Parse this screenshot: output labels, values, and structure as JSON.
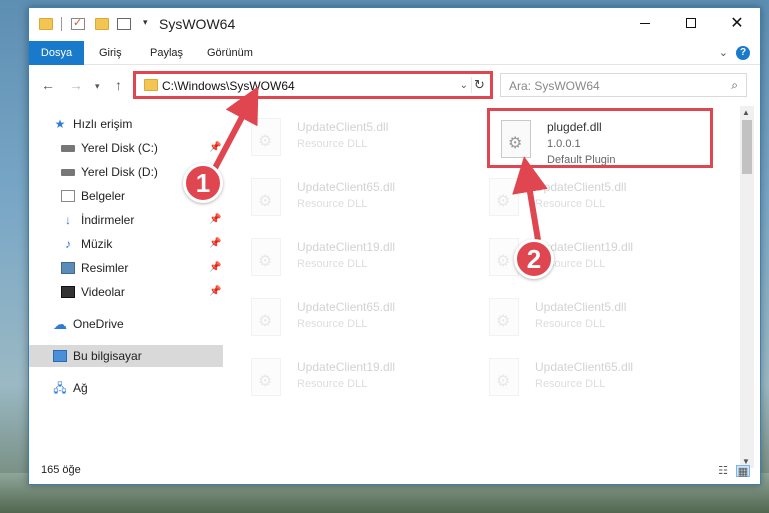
{
  "window": {
    "title": "SysWOW64"
  },
  "ribbon": {
    "tabs": [
      "Dosya",
      "Giriş",
      "Paylaş",
      "Görünüm"
    ],
    "help": "?"
  },
  "address": {
    "path": "C:\\Windows\\SysWOW64",
    "search_placeholder": "Ara: SysWOW64"
  },
  "nav": {
    "items": [
      {
        "label": "Hızlı erişim",
        "icon": "star-icon"
      },
      {
        "label": "Yerel Disk (C:)",
        "icon": "drive-icon",
        "pinned": true
      },
      {
        "label": "Yerel Disk (D:)",
        "icon": "drive-icon"
      },
      {
        "label": "Belgeler",
        "icon": "documents-icon"
      },
      {
        "label": "İndirmeler",
        "icon": "download-icon",
        "pinned": true
      },
      {
        "label": "Müzik",
        "icon": "music-icon",
        "pinned": true
      },
      {
        "label": "Resimler",
        "icon": "pictures-icon",
        "pinned": true
      },
      {
        "label": "Videolar",
        "icon": "video-icon",
        "pinned": true
      },
      {
        "label": "OneDrive",
        "icon": "cloud-icon"
      },
      {
        "label": "Bu bilgisayar",
        "icon": "computer-icon",
        "selected": true
      },
      {
        "label": "Ağ",
        "icon": "network-icon"
      }
    ]
  },
  "files": {
    "highlighted": {
      "name": "plugdef.dll",
      "version": "1.0.0.1",
      "description": "Default Plugin"
    },
    "left_column": [
      {
        "name": "UpdateClient5.dll",
        "description": "Resource DLL"
      },
      {
        "name": "UpdateClient65.dll",
        "description": "Resource DLL"
      },
      {
        "name": "UpdateClient19.dll",
        "description": "Resource DLL"
      },
      {
        "name": "UpdateClient65.dll",
        "description": "Resource DLL"
      },
      {
        "name": "UpdateClient19.dll",
        "description": "Resource DLL"
      }
    ],
    "right_column": [
      {
        "name": "UpdateClient5.dll",
        "description": "Resource DLL"
      },
      {
        "name": "UpdateClient19.dll",
        "description": "Resource DLL"
      },
      {
        "name": "UpdateClient5.dll",
        "description": "Resource DLL"
      },
      {
        "name": "UpdateClient65.dll",
        "description": "Resource DLL"
      }
    ]
  },
  "status": {
    "count": "165 öğe"
  },
  "annotations": {
    "step1": "1",
    "step2": "2",
    "color": "#e0464f"
  }
}
